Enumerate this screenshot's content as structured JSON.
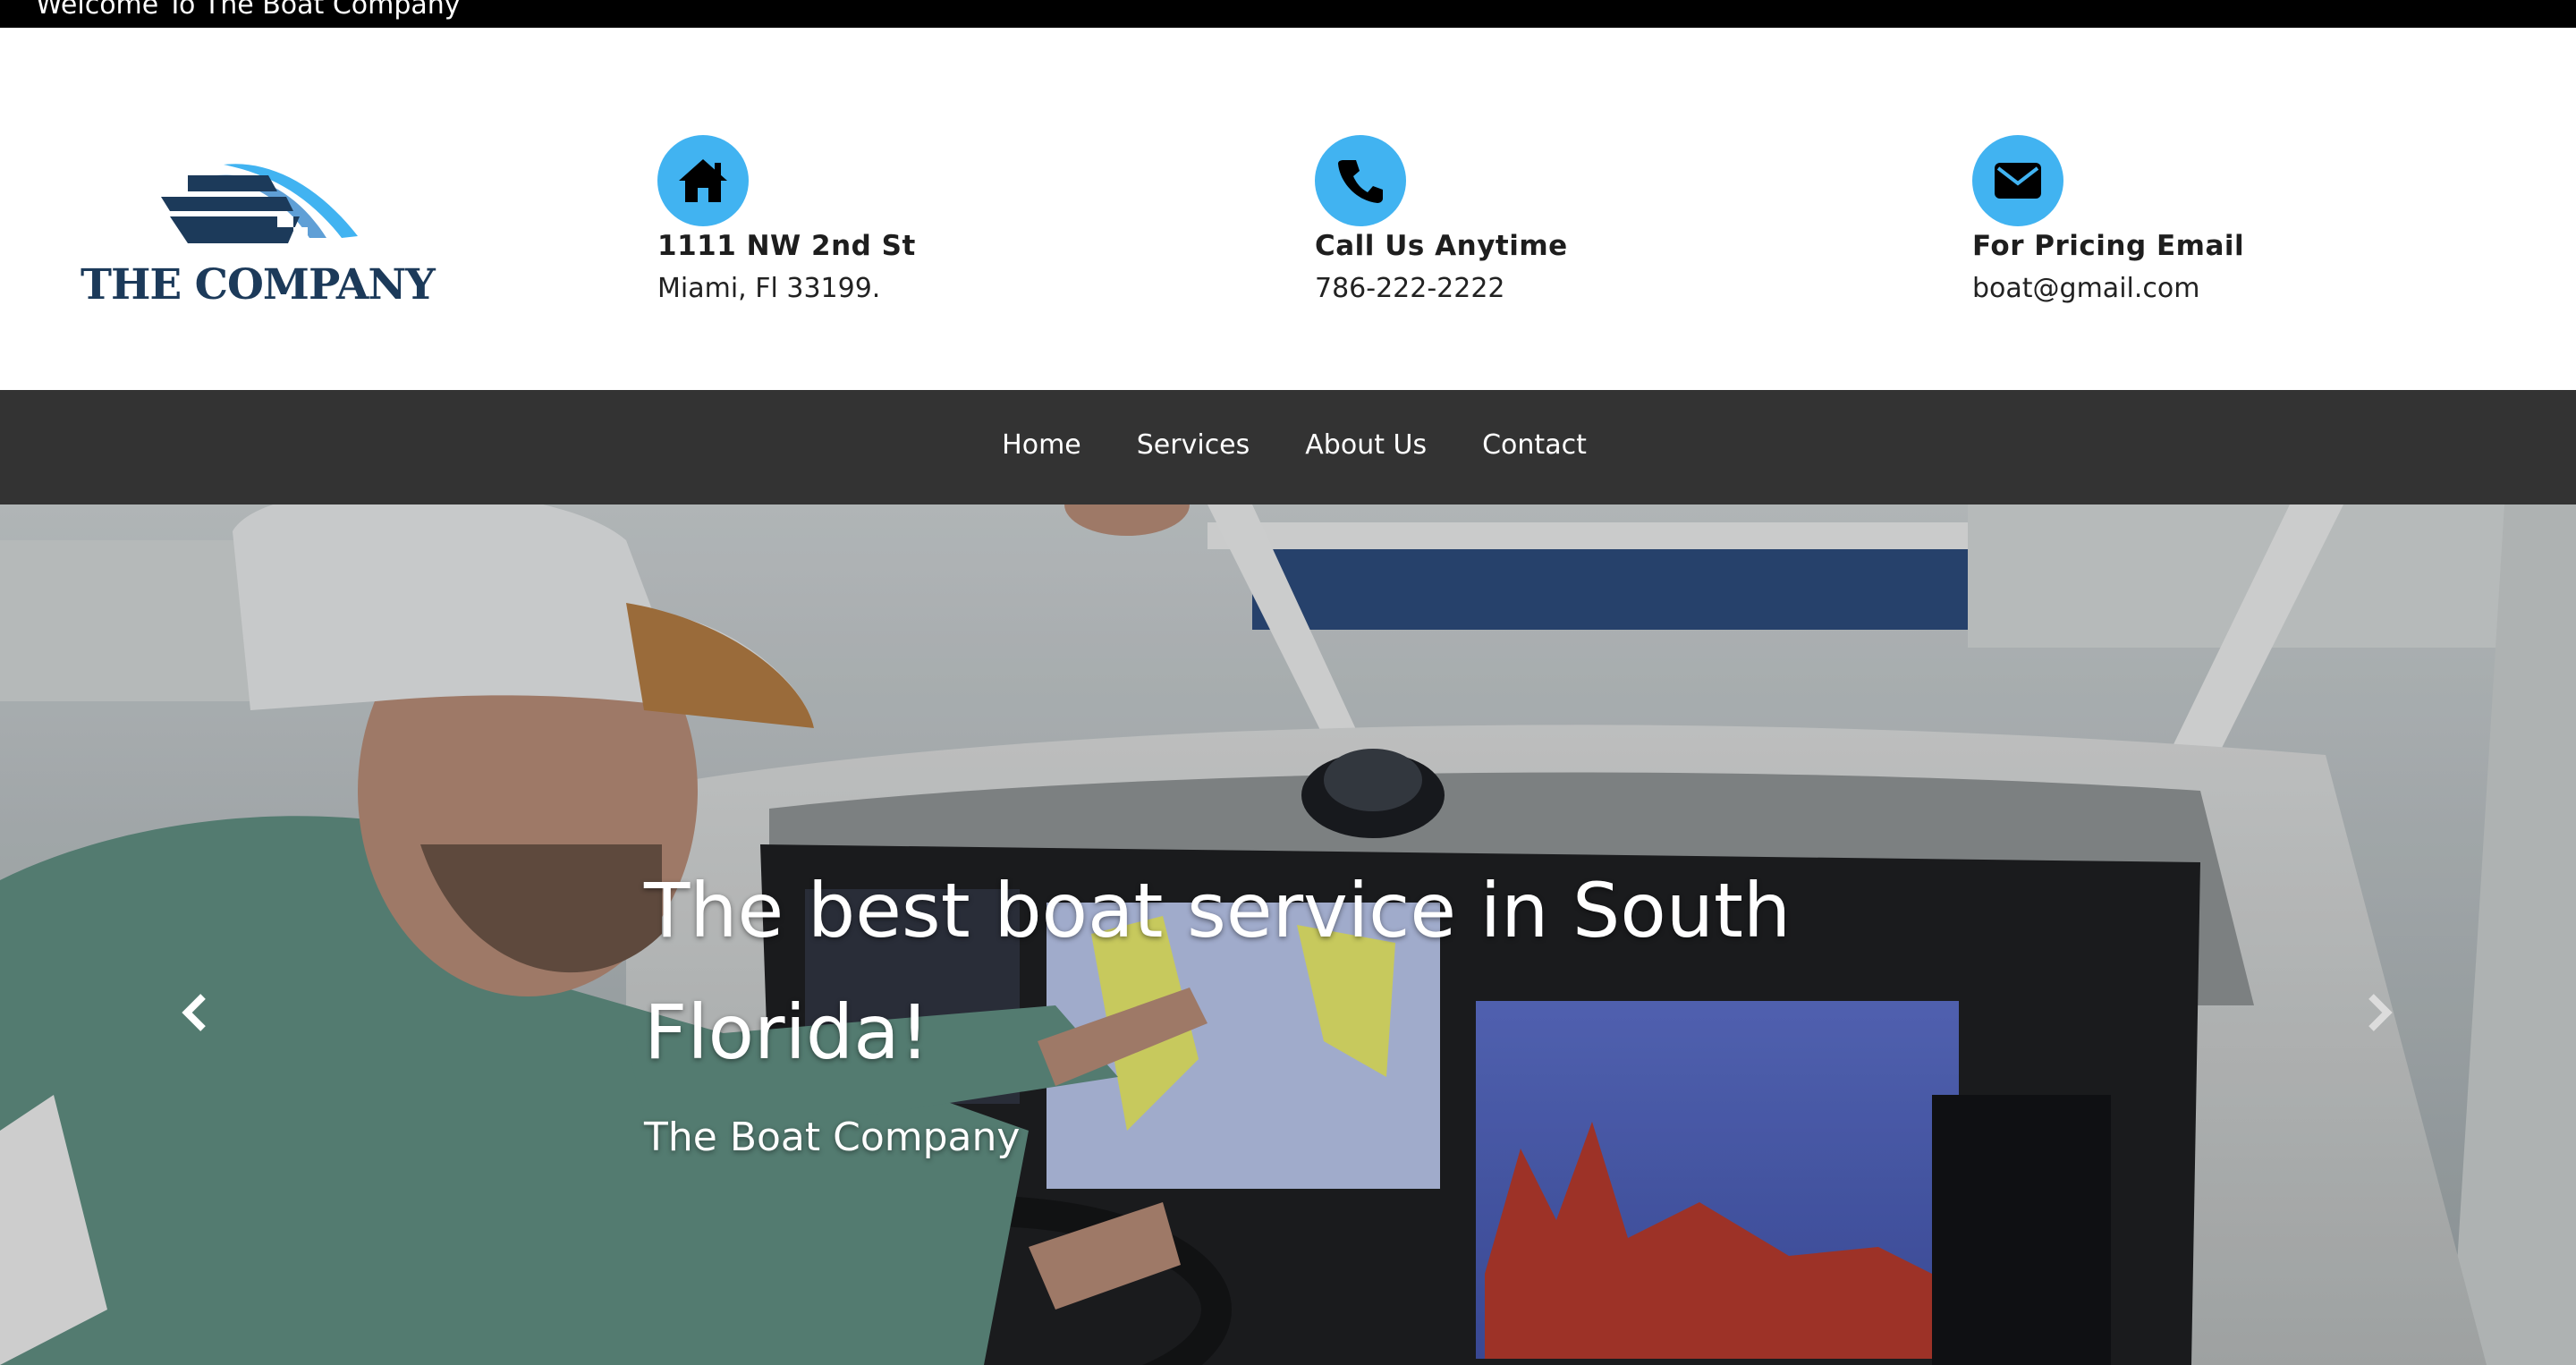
{
  "topbar": {
    "welcome": "Welcome To The Boat Company"
  },
  "logo": {
    "text": "THE COMPANY"
  },
  "contacts": [
    {
      "icon": "home-icon",
      "title": "1111 NW 2nd St",
      "sub": "Miami, Fl 33199."
    },
    {
      "icon": "phone-icon",
      "title": "Call Us Anytime",
      "sub": "786-222-2222"
    },
    {
      "icon": "envelope-icon",
      "title": "For Pricing Email",
      "sub": "boat@gmail.com"
    }
  ],
  "nav": {
    "items": [
      {
        "label": "Home"
      },
      {
        "label": "Services"
      },
      {
        "label": "About Us"
      },
      {
        "label": "Contact"
      }
    ]
  },
  "hero": {
    "headline": "The best boat service in South Florida!",
    "subline": "The Boat Company",
    "prev_icon": "chevron-left-icon",
    "next_icon": "chevron-right-icon"
  },
  "colors": {
    "accent": "#41b3f1",
    "nav_bg": "#333333",
    "topbar_bg": "#000000",
    "logo_navy": "#1c3a5a"
  }
}
